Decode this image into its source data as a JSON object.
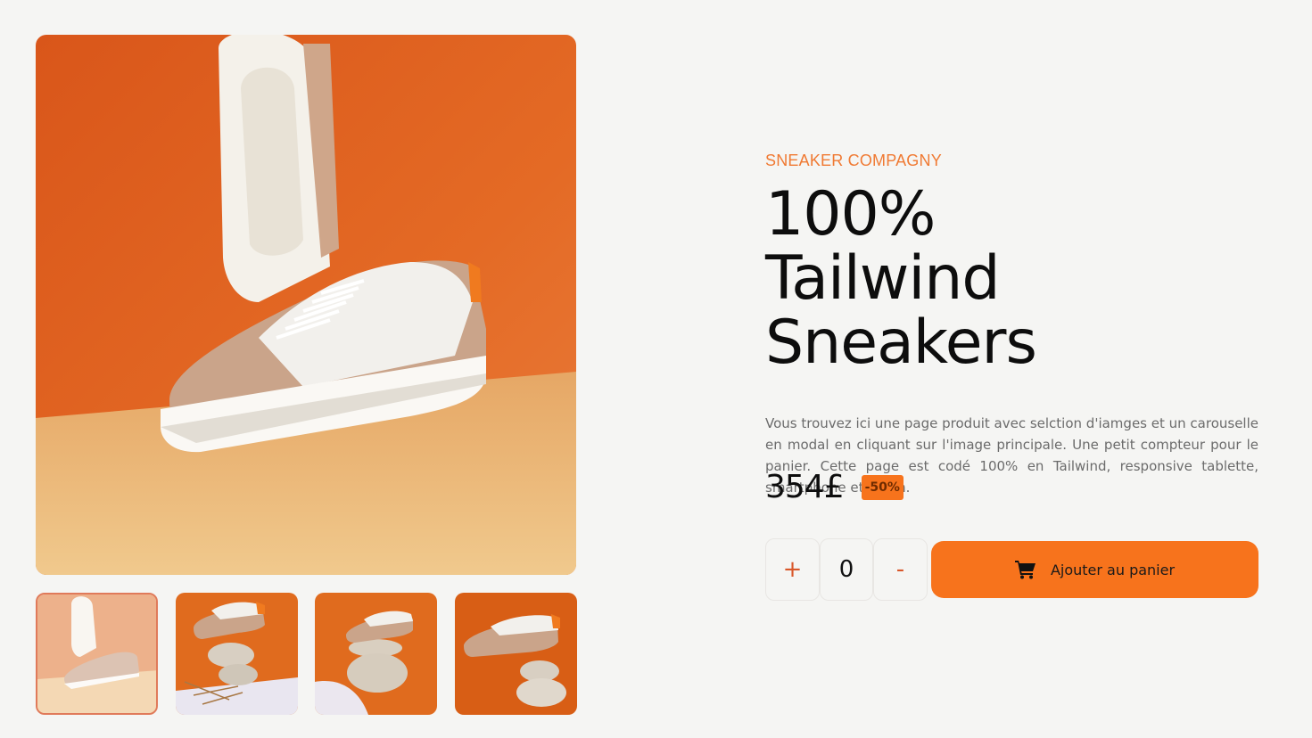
{
  "product": {
    "brand": "SNEAKER COMPAGNY",
    "title": "100% Tailwind Sneakers",
    "description": "Vous trouvez ici une page produit avec selction d'iamges et un carouselle en modal en cliquant sur l'image principale. Une petit compteur pour le panier. Cette page est codé 100% en Tailwind, responsive tablette, smartphone et ecran.",
    "price": "354£",
    "discount": "-50%"
  },
  "cart": {
    "increment_label": "+",
    "quantity": "0",
    "decrement_label": "-",
    "add_label": "Ajouter au panier",
    "icon": "cart-icon"
  },
  "gallery": {
    "active_index": 0,
    "thumbnail_count": 4
  },
  "colors": {
    "accent": "#f7731c",
    "brand_text": "#f07a33",
    "background": "#f5f5f3"
  }
}
